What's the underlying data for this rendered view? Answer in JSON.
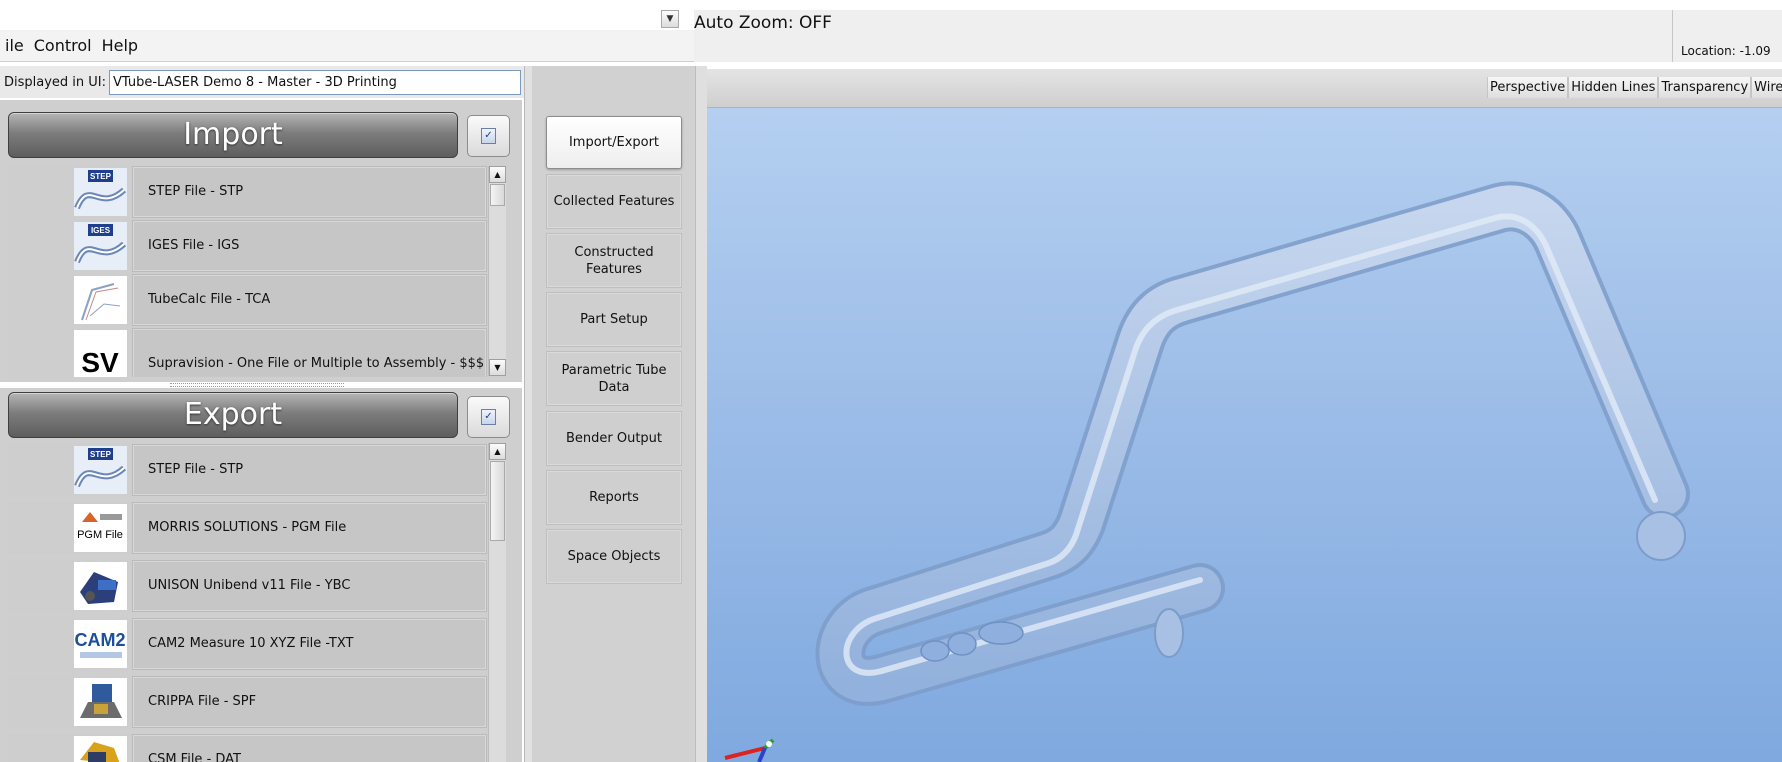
{
  "menu": {
    "items": [
      "ile",
      "Control",
      "Help"
    ],
    "dropdown_glyph": "▼"
  },
  "model_bar": {
    "label": "Displayed in UI:",
    "value": "VTube-LASER Demo 8 - Master - 3D Printing"
  },
  "import_panel": {
    "title": "Import",
    "items": [
      {
        "label": "STEP File - STP",
        "icon": "step-icon",
        "thumb_text": "STEP"
      },
      {
        "label": "IGES File - IGS",
        "icon": "iges-icon",
        "thumb_text": "IGES"
      },
      {
        "label": "TubeCalc File - TCA",
        "icon": "tubecalc-icon",
        "thumb_text": ""
      },
      {
        "label": "Supravision - One File or Multiple to Assembly - $$$",
        "icon": "supravision-icon",
        "thumb_text": "SV"
      }
    ]
  },
  "export_panel": {
    "title": "Export",
    "items": [
      {
        "label": "STEP File - STP",
        "icon": "step-icon",
        "thumb_text": "STEP"
      },
      {
        "label": "MORRIS SOLUTIONS - PGM File",
        "icon": "morris-pgm-icon",
        "thumb_text": "PGM File"
      },
      {
        "label": "UNISON Unibend v11 File - YBC",
        "icon": "unison-icon",
        "thumb_text": ""
      },
      {
        "label": "CAM2 Measure 10 XYZ File -TXT",
        "icon": "cam2-icon",
        "thumb_text": "CAM2"
      },
      {
        "label": "CRIPPA File - SPF",
        "icon": "crippa-icon",
        "thumb_text": ""
      },
      {
        "label": "CSM File - DAT",
        "icon": "csm-icon",
        "thumb_text": ""
      }
    ]
  },
  "nav": {
    "buttons": [
      {
        "label": "Import/Export",
        "active": true
      },
      {
        "label": "Collected Features",
        "active": false
      },
      {
        "label": "Constructed Features",
        "active": false
      },
      {
        "label": "Part Setup",
        "active": false
      },
      {
        "label": "Parametric Tube Data",
        "active": false
      },
      {
        "label": "Bender Output",
        "active": false
      },
      {
        "label": "Reports",
        "active": false
      },
      {
        "label": "Space Objects",
        "active": false
      }
    ]
  },
  "status": {
    "auto_zoom": "Auto Zoom: OFF",
    "location": "Location: -1.09"
  },
  "view_toolbar": {
    "buttons": [
      "Perspective",
      "Hidden Lines",
      "Transparency",
      "Wirefra"
    ]
  },
  "colors": {
    "viewport_top": "#b4cff0",
    "viewport_bottom": "#7fa9df",
    "tube": "#a9c2e6",
    "panel_header": "#6f6f6f"
  }
}
